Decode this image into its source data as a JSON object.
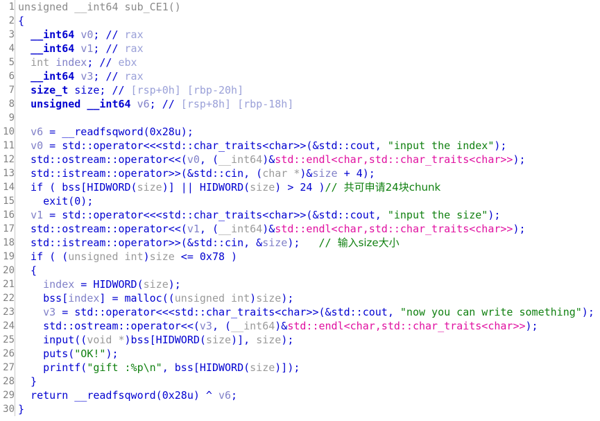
{
  "view": {
    "name": "decompiler-pseudocode",
    "title": "unsigned __int64 sub_CE1()",
    "background_color": "#ffffff",
    "gutter_color": "#808080",
    "total_lines": 30
  },
  "colors": {
    "code_blue": "#0000d0",
    "local_var": "#8080c8",
    "dim_gray": "#9a9a9a",
    "string_green": "#108010",
    "comment_green": "#108010",
    "library_magenta": "#e010a0",
    "signature_gray": "#8a8a8a",
    "line_number_gray": "#808080"
  },
  "lines": [
    {
      "n": "1",
      "tokens": [
        {
          "t": "unsigned __int64 sub_CE1()",
          "c": "t-sig"
        }
      ]
    },
    {
      "n": "2",
      "tokens": [
        {
          "t": "{",
          "c": "t-plain"
        }
      ]
    },
    {
      "n": "3",
      "tokens": [
        {
          "t": "  ",
          "c": "t-plain"
        },
        {
          "t": "__int64",
          "c": "t-kw"
        },
        {
          "t": " ",
          "c": "t-plain"
        },
        {
          "t": "v0",
          "c": "t-lvar"
        },
        {
          "t": "; ",
          "c": "t-plain"
        },
        {
          "t": "//",
          "c": "t-cmt-slash"
        },
        {
          "t": " rax",
          "c": "t-reg"
        }
      ]
    },
    {
      "n": "4",
      "tokens": [
        {
          "t": "  ",
          "c": "t-plain"
        },
        {
          "t": "__int64",
          "c": "t-kw"
        },
        {
          "t": " ",
          "c": "t-plain"
        },
        {
          "t": "v1",
          "c": "t-lvar"
        },
        {
          "t": "; ",
          "c": "t-plain"
        },
        {
          "t": "//",
          "c": "t-cmt-slash"
        },
        {
          "t": " rax",
          "c": "t-reg"
        }
      ]
    },
    {
      "n": "5",
      "tokens": [
        {
          "t": "  ",
          "c": "t-plain"
        },
        {
          "t": "int",
          "c": "t-dim"
        },
        {
          "t": " ",
          "c": "t-plain"
        },
        {
          "t": "index",
          "c": "t-lvar"
        },
        {
          "t": "; ",
          "c": "t-plain"
        },
        {
          "t": "//",
          "c": "t-cmt-slash"
        },
        {
          "t": " ebx",
          "c": "t-reg"
        }
      ]
    },
    {
      "n": "6",
      "tokens": [
        {
          "t": "  ",
          "c": "t-plain"
        },
        {
          "t": "__int64",
          "c": "t-kw"
        },
        {
          "t": " ",
          "c": "t-plain"
        },
        {
          "t": "v3",
          "c": "t-lvar"
        },
        {
          "t": "; ",
          "c": "t-plain"
        },
        {
          "t": "//",
          "c": "t-cmt-slash"
        },
        {
          "t": " rax",
          "c": "t-reg"
        }
      ]
    },
    {
      "n": "7",
      "tokens": [
        {
          "t": "  ",
          "c": "t-plain"
        },
        {
          "t": "size_t",
          "c": "t-kw"
        },
        {
          "t": " size; ",
          "c": "t-plain"
        },
        {
          "t": "//",
          "c": "t-cmt-slash"
        },
        {
          "t": " [rsp+0h] [rbp-20h]",
          "c": "t-reg"
        }
      ]
    },
    {
      "n": "8",
      "tokens": [
        {
          "t": "  ",
          "c": "t-plain"
        },
        {
          "t": "unsigned __int64",
          "c": "t-kw"
        },
        {
          "t": " ",
          "c": "t-plain"
        },
        {
          "t": "v6",
          "c": "t-lvar"
        },
        {
          "t": "; ",
          "c": "t-plain"
        },
        {
          "t": "//",
          "c": "t-cmt-slash"
        },
        {
          "t": " [rsp+8h] [rbp-18h]",
          "c": "t-reg"
        }
      ]
    },
    {
      "n": "9",
      "tokens": [
        {
          "t": "",
          "c": "t-plain"
        }
      ]
    },
    {
      "n": "10",
      "tokens": [
        {
          "t": "  ",
          "c": "t-plain"
        },
        {
          "t": "v6",
          "c": "t-lvar"
        },
        {
          "t": " = __readfsqword(0x28u);",
          "c": "t-plain"
        }
      ]
    },
    {
      "n": "11",
      "tokens": [
        {
          "t": "  ",
          "c": "t-plain"
        },
        {
          "t": "v0",
          "c": "t-lvar"
        },
        {
          "t": " = std::operator<<<std::char_traits<char>>(&std::cout, ",
          "c": "t-plain"
        },
        {
          "t": "\"input the index\"",
          "c": "t-str"
        },
        {
          "t": ");",
          "c": "t-plain"
        }
      ]
    },
    {
      "n": "12",
      "tokens": [
        {
          "t": "  std::ostream::operator<<(",
          "c": "t-plain"
        },
        {
          "t": "v0",
          "c": "t-lvar"
        },
        {
          "t": ", (",
          "c": "t-plain"
        },
        {
          "t": "__int64",
          "c": "t-dim"
        },
        {
          "t": ")&",
          "c": "t-plain"
        },
        {
          "t": "std::endl<char,std::char_traits<char>>",
          "c": "t-lib"
        },
        {
          "t": ");",
          "c": "t-plain"
        }
      ]
    },
    {
      "n": "13",
      "tokens": [
        {
          "t": "  std::istream::operator>>(&std::cin, (",
          "c": "t-plain"
        },
        {
          "t": "char *",
          "c": "t-dim"
        },
        {
          "t": ")&",
          "c": "t-plain"
        },
        {
          "t": "size",
          "c": "t-lvar"
        },
        {
          "t": " + 4);",
          "c": "t-plain"
        }
      ]
    },
    {
      "n": "14",
      "tokens": [
        {
          "t": "  if ( bss[HIDWORD(",
          "c": "t-plain"
        },
        {
          "t": "size",
          "c": "t-dim"
        },
        {
          "t": ")] || HIDWORD(",
          "c": "t-plain"
        },
        {
          "t": "size",
          "c": "t-dim"
        },
        {
          "t": ") > 24 )",
          "c": "t-plain"
        },
        {
          "t": "// ",
          "c": "t-cmt"
        },
        {
          "t": "共可申请24块chunk",
          "c": "t-cmt cjk"
        }
      ]
    },
    {
      "n": "15",
      "tokens": [
        {
          "t": "    exit(0);",
          "c": "t-plain"
        }
      ]
    },
    {
      "n": "16",
      "tokens": [
        {
          "t": "  ",
          "c": "t-plain"
        },
        {
          "t": "v1",
          "c": "t-lvar"
        },
        {
          "t": " = std::operator<<<std::char_traits<char>>(&std::cout, ",
          "c": "t-plain"
        },
        {
          "t": "\"input the size\"",
          "c": "t-str"
        },
        {
          "t": ");",
          "c": "t-plain"
        }
      ]
    },
    {
      "n": "17",
      "tokens": [
        {
          "t": "  std::ostream::operator<<(",
          "c": "t-plain"
        },
        {
          "t": "v1",
          "c": "t-lvar"
        },
        {
          "t": ", (",
          "c": "t-plain"
        },
        {
          "t": "__int64",
          "c": "t-dim"
        },
        {
          "t": ")&",
          "c": "t-plain"
        },
        {
          "t": "std::endl<char,std::char_traits<char>>",
          "c": "t-lib"
        },
        {
          "t": ");",
          "c": "t-plain"
        }
      ]
    },
    {
      "n": "18",
      "tokens": [
        {
          "t": "  std::istream::operator>>(&std::cin, &",
          "c": "t-plain"
        },
        {
          "t": "size",
          "c": "t-lvar"
        },
        {
          "t": ");   ",
          "c": "t-plain"
        },
        {
          "t": "// ",
          "c": "t-cmt"
        },
        {
          "t": "输入size大小",
          "c": "t-cmt cjk"
        }
      ]
    },
    {
      "n": "19",
      "tokens": [
        {
          "t": "  if ( (",
          "c": "t-plain"
        },
        {
          "t": "unsigned int",
          "c": "t-dim"
        },
        {
          "t": ")",
          "c": "t-plain"
        },
        {
          "t": "size",
          "c": "t-dim"
        },
        {
          "t": " <= 0x78 )",
          "c": "t-plain"
        }
      ]
    },
    {
      "n": "20",
      "tokens": [
        {
          "t": "  {",
          "c": "t-plain"
        }
      ]
    },
    {
      "n": "21",
      "tokens": [
        {
          "t": "    ",
          "c": "t-plain"
        },
        {
          "t": "index",
          "c": "t-lvar"
        },
        {
          "t": " = HIDWORD(",
          "c": "t-plain"
        },
        {
          "t": "size",
          "c": "t-dim"
        },
        {
          "t": ");",
          "c": "t-plain"
        }
      ]
    },
    {
      "n": "22",
      "tokens": [
        {
          "t": "    bss[",
          "c": "t-plain"
        },
        {
          "t": "index",
          "c": "t-lvar"
        },
        {
          "t": "] = malloc((",
          "c": "t-plain"
        },
        {
          "t": "unsigned int",
          "c": "t-dim"
        },
        {
          "t": ")",
          "c": "t-plain"
        },
        {
          "t": "size",
          "c": "t-dim"
        },
        {
          "t": ");",
          "c": "t-plain"
        }
      ]
    },
    {
      "n": "23",
      "tokens": [
        {
          "t": "    ",
          "c": "t-plain"
        },
        {
          "t": "v3",
          "c": "t-lvar"
        },
        {
          "t": " = std::operator<<<std::char_traits<char>>(&std::cout, ",
          "c": "t-plain"
        },
        {
          "t": "\"now you can write something\"",
          "c": "t-str"
        },
        {
          "t": ");",
          "c": "t-plain"
        }
      ]
    },
    {
      "n": "24",
      "tokens": [
        {
          "t": "    std::ostream::operator<<(",
          "c": "t-plain"
        },
        {
          "t": "v3",
          "c": "t-lvar"
        },
        {
          "t": ", (",
          "c": "t-plain"
        },
        {
          "t": "__int64",
          "c": "t-dim"
        },
        {
          "t": ")&",
          "c": "t-plain"
        },
        {
          "t": "std::endl<char,std::char_traits<char>>",
          "c": "t-lib"
        },
        {
          "t": ");",
          "c": "t-plain"
        }
      ]
    },
    {
      "n": "25",
      "tokens": [
        {
          "t": "    input((",
          "c": "t-plain"
        },
        {
          "t": "void *",
          "c": "t-dim"
        },
        {
          "t": ")bss[HIDWORD(",
          "c": "t-plain"
        },
        {
          "t": "size",
          "c": "t-dim"
        },
        {
          "t": ")], ",
          "c": "t-plain"
        },
        {
          "t": "size",
          "c": "t-dim"
        },
        {
          "t": ");",
          "c": "t-plain"
        }
      ]
    },
    {
      "n": "26",
      "tokens": [
        {
          "t": "    puts(",
          "c": "t-plain"
        },
        {
          "t": "\"OK!\"",
          "c": "t-str"
        },
        {
          "t": ");",
          "c": "t-plain"
        }
      ]
    },
    {
      "n": "27",
      "tokens": [
        {
          "t": "    printf(",
          "c": "t-plain"
        },
        {
          "t": "\"gift :%p\\n\"",
          "c": "t-str"
        },
        {
          "t": ", bss[HIDWORD(",
          "c": "t-plain"
        },
        {
          "t": "size",
          "c": "t-dim"
        },
        {
          "t": ")]);",
          "c": "t-plain"
        }
      ]
    },
    {
      "n": "28",
      "tokens": [
        {
          "t": "  }",
          "c": "t-plain"
        }
      ]
    },
    {
      "n": "29",
      "tokens": [
        {
          "t": "  return __readfsqword(0x28u) ^ ",
          "c": "t-plain"
        },
        {
          "t": "v6",
          "c": "t-lvar"
        },
        {
          "t": ";",
          "c": "t-plain"
        }
      ]
    },
    {
      "n": "30",
      "tokens": [
        {
          "t": "}",
          "c": "t-plain"
        }
      ]
    }
  ]
}
